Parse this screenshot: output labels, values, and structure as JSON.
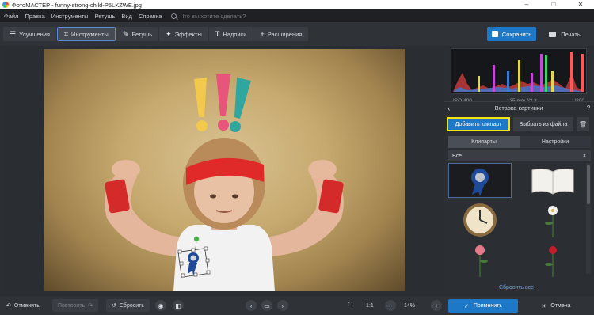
{
  "window": {
    "title": "ФотоМАСТЕР - funny-strong-child-P5LKZWE.jpg",
    "controls": [
      "–",
      "□",
      "✕"
    ]
  },
  "menu": {
    "items": [
      "Файл",
      "Правка",
      "Инструменты",
      "Ретушь",
      "Вид",
      "Справка"
    ],
    "search_placeholder": "Что вы хотите сделать?"
  },
  "toolbar": {
    "tabs": [
      {
        "label": "Улучшения",
        "icon": "sliders-icon"
      },
      {
        "label": "Инструменты",
        "icon": "crop-icon",
        "active": true
      },
      {
        "label": "Ретушь",
        "icon": "brush-icon"
      },
      {
        "label": "Эффекты",
        "icon": "magic-wand-icon"
      },
      {
        "label": "Надписи",
        "icon": "text-icon"
      },
      {
        "label": "Расширения",
        "icon": "plus-icon"
      }
    ],
    "save_label": "Сохранить",
    "print_label": "Печать"
  },
  "histogram": {
    "iso": "ISO 400",
    "lens": "135 mm f/3.2",
    "shutter": "1/200"
  },
  "panel": {
    "title": "Вставка картинки",
    "add_clipart_label": "Добавить клипарт",
    "choose_file_label": "Выбрать из файла",
    "subtabs": [
      "Клипарты",
      "Настройки"
    ],
    "category_selected": "Все",
    "clipart_items": [
      "rosette-award",
      "open-book",
      "vintage-clock",
      "white-flower",
      "pink-rose",
      "red-rose"
    ],
    "reset_all_label": "Сбросить все"
  },
  "bottombar": {
    "undo_label": "Отменить",
    "redo_label": "Повторить",
    "reset_label": "Сбросить",
    "ratio_label": "1:1",
    "zoom_value": "14%",
    "apply_label": "Применить",
    "cancel_label": "Отмена"
  },
  "colors": {
    "accent": "#1e78c8",
    "highlight": "#f4e40f",
    "background": "#2b2e33"
  }
}
